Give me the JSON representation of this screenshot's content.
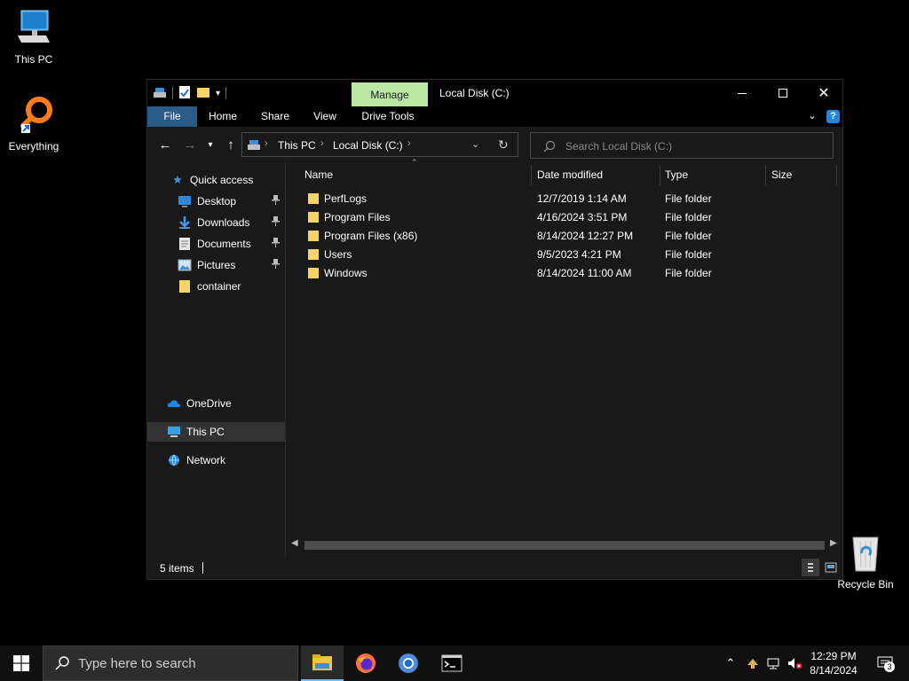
{
  "desktop": {
    "icons": [
      {
        "label": "This PC"
      },
      {
        "label": "Everything"
      },
      {
        "label": "Recycle Bin"
      }
    ]
  },
  "window": {
    "title": "Local Disk (C:)",
    "manage_tab": "Manage",
    "ribbon_tabs": [
      "File",
      "Home",
      "Share",
      "View",
      "Drive Tools"
    ],
    "help_glyph": "?"
  },
  "address": {
    "crumbs": [
      "This PC",
      "Local Disk (C:)"
    ],
    "search_placeholder": "Search Local Disk (C:)"
  },
  "nav": {
    "quick_access": "Quick access",
    "items": [
      {
        "label": "Desktop",
        "icon": "desktop-icon",
        "pinned": true
      },
      {
        "label": "Downloads",
        "icon": "downloads-icon",
        "pinned": true
      },
      {
        "label": "Documents",
        "icon": "documents-icon",
        "pinned": true
      },
      {
        "label": "Pictures",
        "icon": "pictures-icon",
        "pinned": true
      },
      {
        "label": "container",
        "icon": "folder-icon",
        "pinned": false
      }
    ],
    "onedrive": "OneDrive",
    "this_pc": "This PC",
    "network": "Network"
  },
  "columns": [
    "Name",
    "Date modified",
    "Type",
    "Size"
  ],
  "files": [
    {
      "name": "PerfLogs",
      "date": "12/7/2019 1:14 AM",
      "type": "File folder",
      "size": ""
    },
    {
      "name": "Program Files",
      "date": "4/16/2024 3:51 PM",
      "type": "File folder",
      "size": ""
    },
    {
      "name": "Program Files (x86)",
      "date": "8/14/2024 12:27 PM",
      "type": "File folder",
      "size": ""
    },
    {
      "name": "Users",
      "date": "9/5/2023 4:21 PM",
      "type": "File folder",
      "size": ""
    },
    {
      "name": "Windows",
      "date": "8/14/2024 11:00 AM",
      "type": "File folder",
      "size": ""
    }
  ],
  "status": {
    "item_count": "5 items"
  },
  "taskbar": {
    "search_placeholder": "Type here to search",
    "time": "12:29 PM",
    "date": "8/14/2024",
    "notification_count": "3"
  },
  "colors": {
    "manage_tab": "#b9e8a3",
    "file_tab": "#2a5b86",
    "folder": "#f5d56a",
    "selection": "#333333",
    "help": "#1e88e5"
  }
}
